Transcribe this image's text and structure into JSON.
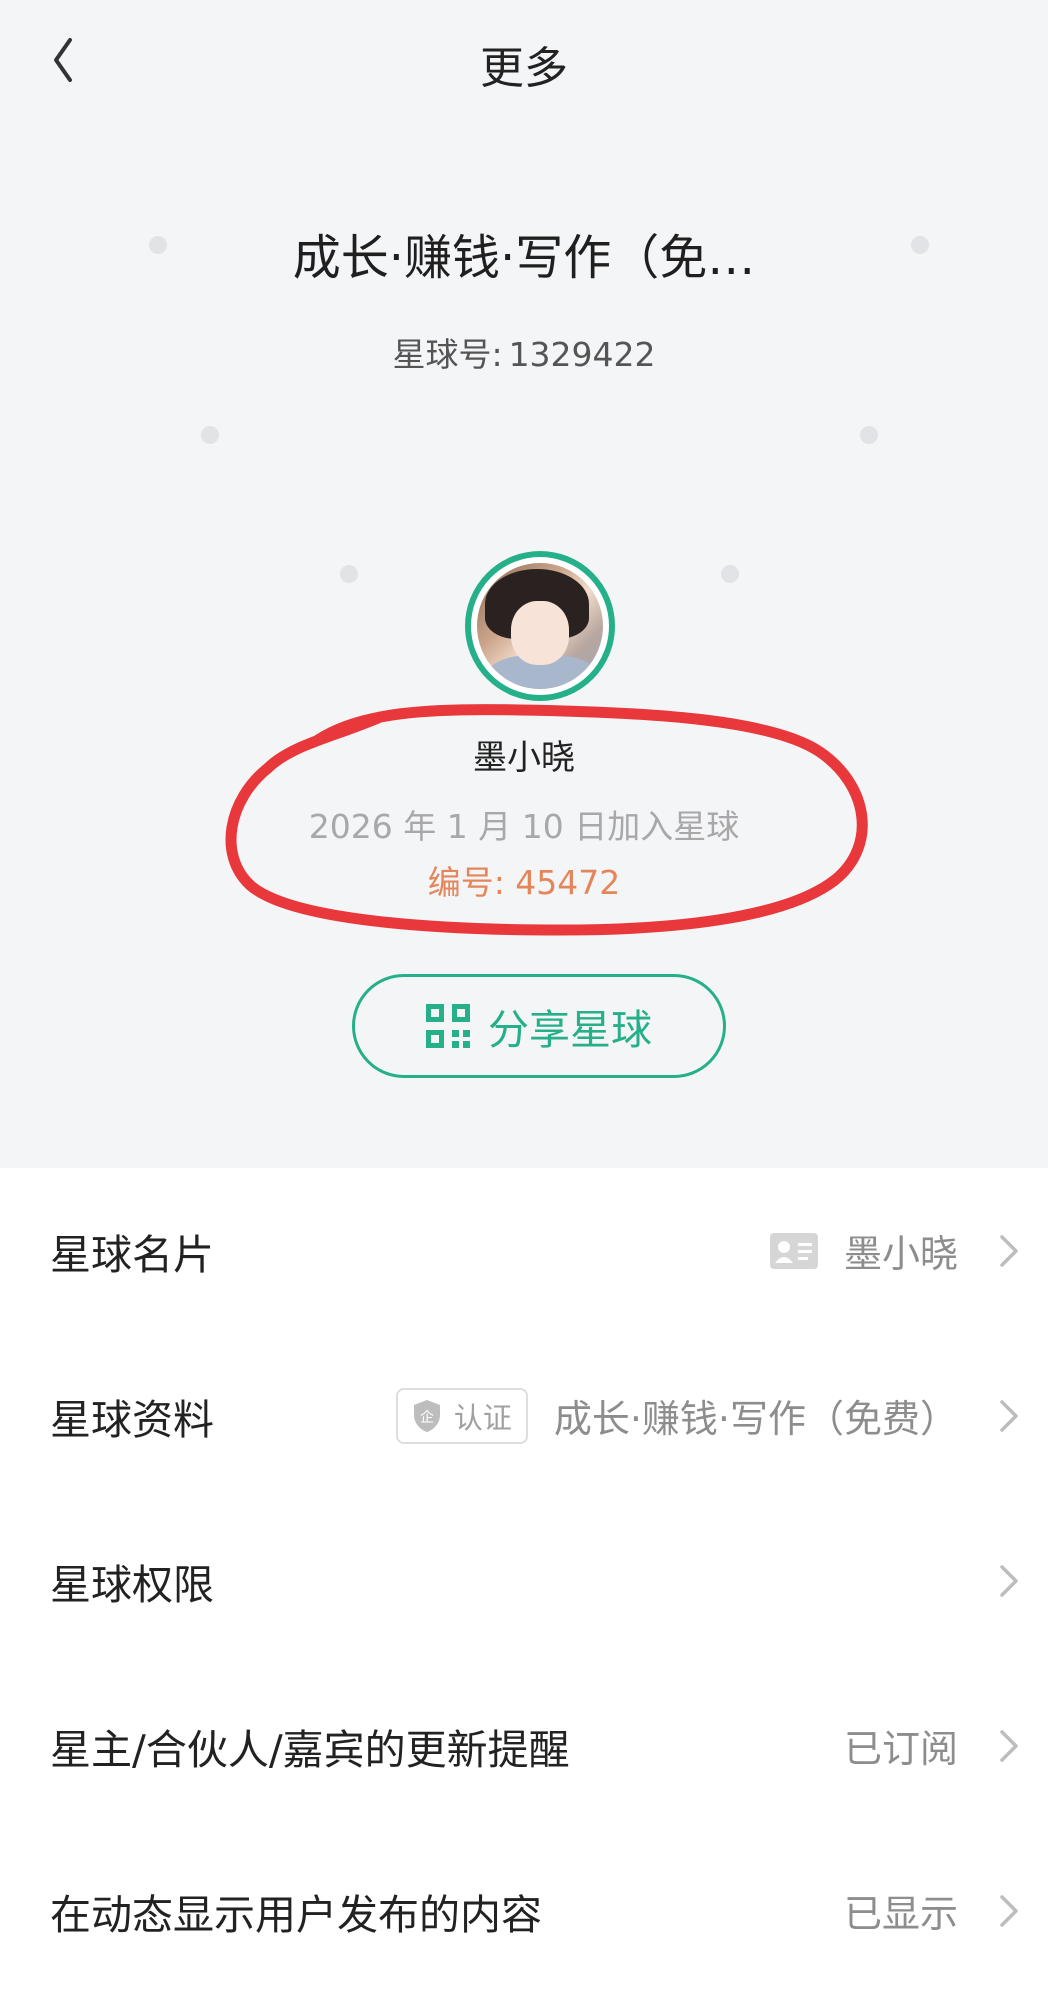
{
  "nav": {
    "title": "更多"
  },
  "group": {
    "title": "成长·赚钱·写作（免…",
    "number_label": "星球号:",
    "number": "1329422"
  },
  "member": {
    "name": "墨小晓",
    "joined": "2026 年 1 月 10 日加入星球",
    "number_text": "编号: 45472"
  },
  "share": {
    "label": "分享星球"
  },
  "rows": [
    {
      "label": "星球名片",
      "value": "墨小晓",
      "icon": "id-card-icon"
    },
    {
      "label": "星球资料",
      "badge": "认证",
      "badge_icon": "shield-icon",
      "value": "成长·赚钱·写作（免费）"
    },
    {
      "label": "星球权限",
      "value": ""
    },
    {
      "label": "星主/合伙人/嘉宾的更新提醒",
      "value": "已订阅"
    },
    {
      "label": "在动态显示用户发布的内容",
      "value": "已显示"
    }
  ],
  "colors": {
    "accent": "#25b089",
    "member_number": "#e4865a",
    "annotation": "#e8383b",
    "header_bg": "#f4f5f7"
  }
}
